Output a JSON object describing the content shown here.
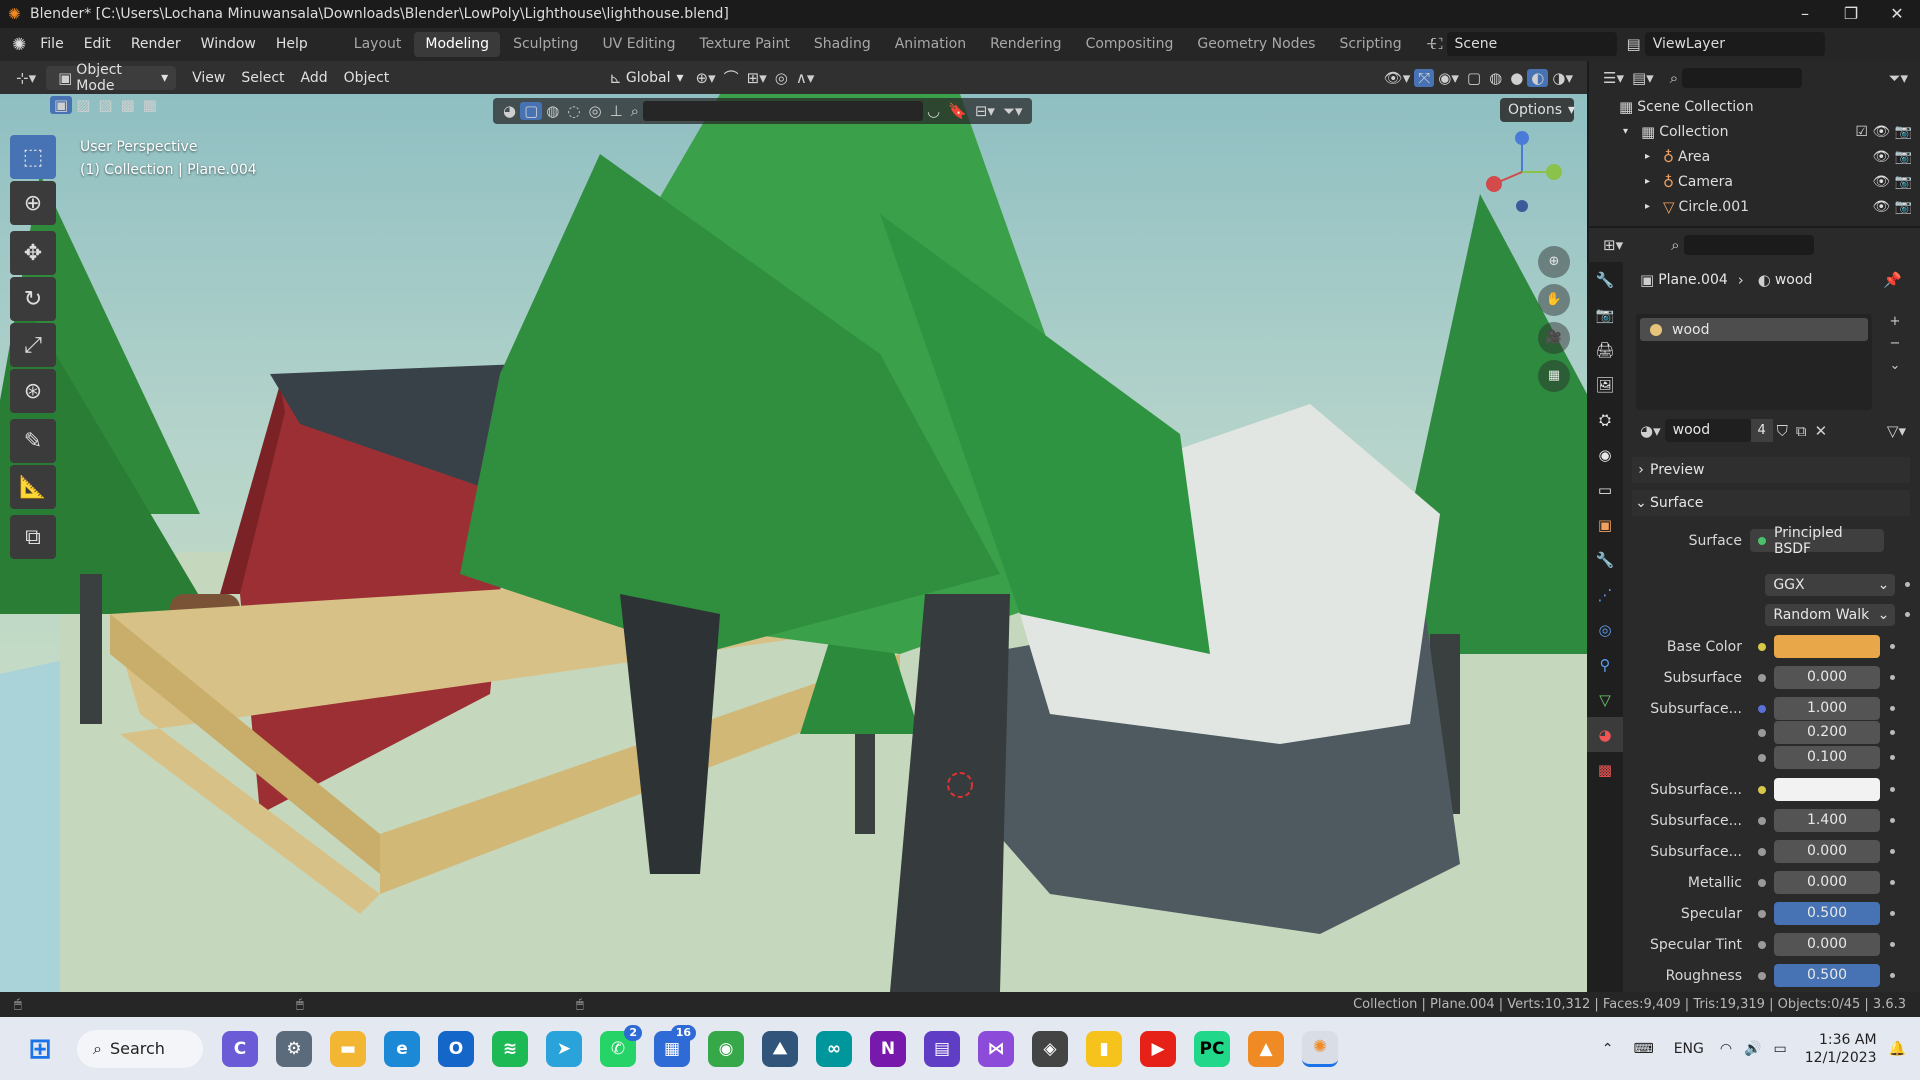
{
  "window": {
    "title": "Blender* [C:\\Users\\Lochana Minuwansala\\Downloads\\Blender\\LowPoly\\Lighthouse\\lighthouse.blend]",
    "controls": [
      "–",
      "❐",
      "✕"
    ]
  },
  "menu": [
    "File",
    "Edit",
    "Render",
    "Window",
    "Help"
  ],
  "workspaces": [
    "Layout",
    "Modeling",
    "Sculpting",
    "UV Editing",
    "Texture Paint",
    "Shading",
    "Animation",
    "Rendering",
    "Compositing",
    "Geometry Nodes",
    "Scripting"
  ],
  "active_workspace": "Modeling",
  "scene": "Scene",
  "view_layer": "ViewLayer",
  "header3d": {
    "mode": "Object Mode",
    "menus": [
      "View",
      "Select",
      "Add",
      "Object"
    ],
    "orientation": "Global",
    "options": "Options"
  },
  "viewport": {
    "perspective": "User Perspective",
    "collection_info": "(1) Collection | Plane.004"
  },
  "tools": [
    "select-box-icon",
    "cursor-icon",
    "move-icon",
    "rotate-icon",
    "scale-icon",
    "transform-icon",
    "annotate-icon",
    "measure-icon",
    "add-cube-icon"
  ],
  "outliner": {
    "root": "Scene Collection",
    "collection": "Collection",
    "items": [
      "Area",
      "Camera",
      "Circle.001"
    ]
  },
  "properties": {
    "object": "Plane.004",
    "material": "wood",
    "slot_name": "wood",
    "users": "4",
    "preview_label": "Preview",
    "surface_label": "Surface",
    "surface_shader_label": "Surface",
    "surface_shader": "Principled BSDF",
    "distribution": "GGX",
    "subsurface_method": "Random Walk",
    "rows": [
      {
        "label": "Base Color",
        "value": "",
        "kind": "color",
        "color": "#e8a849"
      },
      {
        "label": "Subsurface",
        "value": "0.000",
        "kind": "num"
      },
      {
        "label": "Subsurface...",
        "value": "1.000",
        "kind": "num"
      },
      {
        "label": "",
        "value": "0.200",
        "kind": "num"
      },
      {
        "label": "",
        "value": "0.100",
        "kind": "num"
      },
      {
        "label": "Subsurface...",
        "value": "",
        "kind": "color",
        "color": "#f2f2f2"
      },
      {
        "label": "Subsurface...",
        "value": "1.400",
        "kind": "num"
      },
      {
        "label": "Subsurface...",
        "value": "0.000",
        "kind": "num"
      },
      {
        "label": "Metallic",
        "value": "0.000",
        "kind": "num"
      },
      {
        "label": "Specular",
        "value": "0.500",
        "kind": "sel"
      },
      {
        "label": "Specular Tint",
        "value": "0.000",
        "kind": "num"
      },
      {
        "label": "Roughness",
        "value": "0.500",
        "kind": "sel"
      }
    ]
  },
  "status": "Collection | Plane.004 | Verts:10,312 | Faces:9,409 | Tris:19,319 | Objects:0/45 | 3.6.3",
  "taskbar": {
    "search": "Search",
    "lang": "ENG",
    "time": "1:36 AM",
    "date": "12/1/2023",
    "badges": {
      "whatsapp": "2",
      "store": "16"
    }
  }
}
